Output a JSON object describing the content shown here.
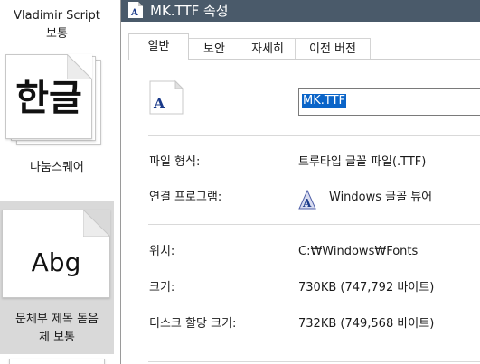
{
  "left_panel": {
    "items": [
      {
        "label_line1": "Vladimir Script",
        "label_line2": "보통"
      },
      {
        "glyph": "한글",
        "label": "나눔스퀘어"
      },
      {
        "glyph": "Abg",
        "label_line1": "문체부 제목 돋음",
        "label_line2": "체 보통"
      }
    ]
  },
  "dialog": {
    "title": "MK.TTF 속성",
    "tabs": [
      {
        "label": "일반",
        "active": true
      },
      {
        "label": "보안"
      },
      {
        "label": "자세히"
      },
      {
        "label": "이전 버전"
      }
    ],
    "file_name": "MK.TTF",
    "file_icon_letter": "A",
    "properties": {
      "file_type_label": "파일 형식:",
      "file_type_value": "트루타입 글꼴 파일(.TTF)",
      "opens_with_label": "연결 프로그램:",
      "opens_with_value": "Windows 글꼴 뷰어",
      "location_label": "위치:",
      "location_value": "C:₩Windows₩Fonts",
      "size_label": "크기:",
      "size_value": "730KB (747,792 바이트)",
      "disk_size_label": "디스크 할당 크기:",
      "disk_size_value": "732KB (749,568 바이트)"
    }
  },
  "colors": {
    "titlebar": "#4a5a6a",
    "selection": "#0a64c8",
    "selected_item_bg": "#d9d9d9"
  }
}
